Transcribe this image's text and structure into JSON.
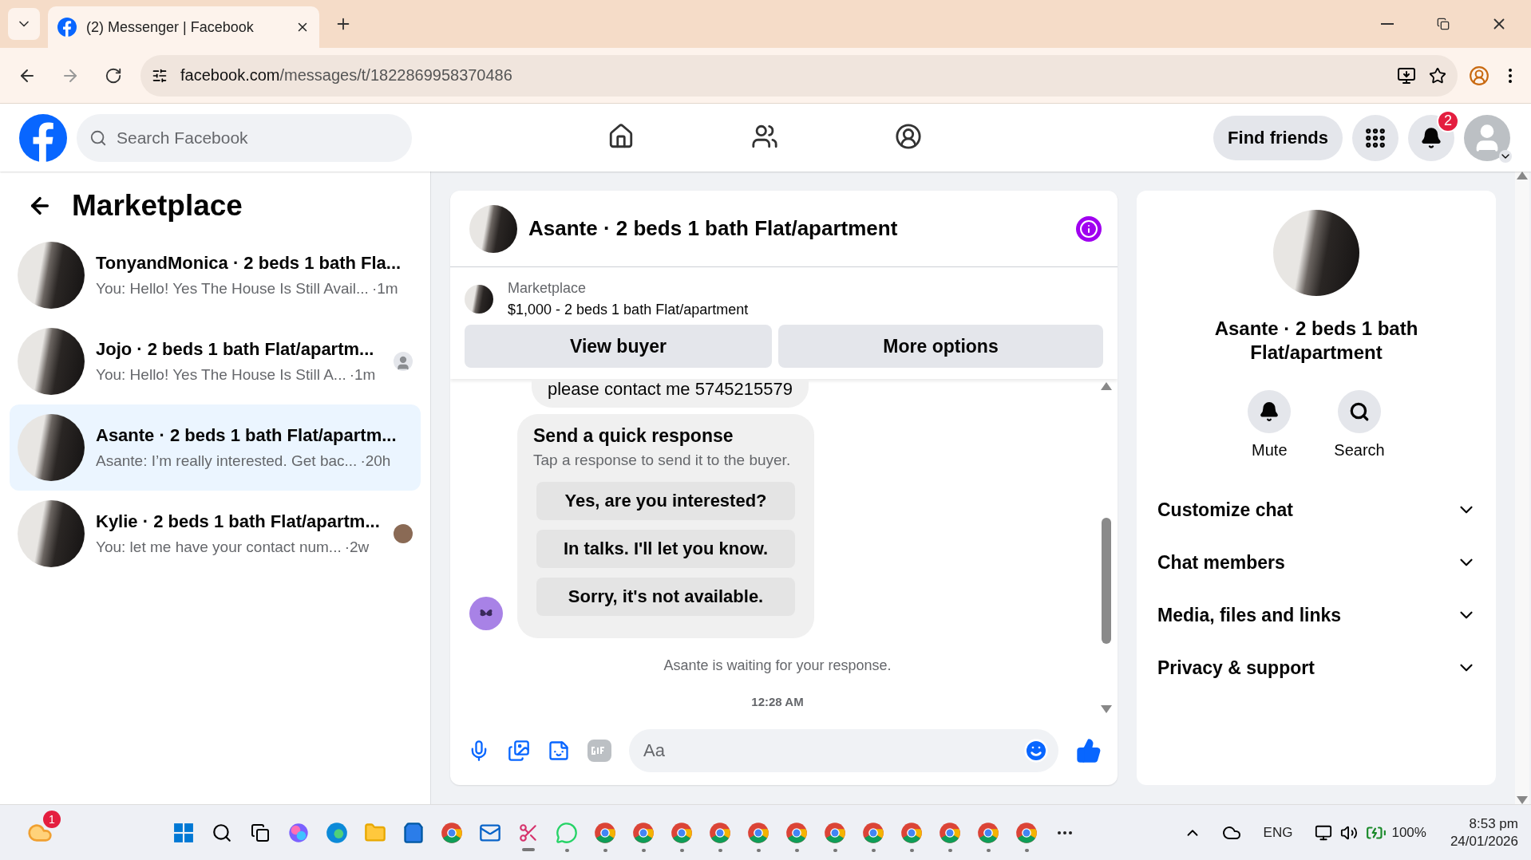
{
  "browser": {
    "tab_title": "(2) Messenger | Facebook",
    "url_host": "facebook.com",
    "url_path": "/messages/t/1822869958370486"
  },
  "header": {
    "search_placeholder": "Search Facebook",
    "find_friends": "Find friends",
    "notification_count": "2",
    "nav": [
      {
        "kind": "home",
        "selected": false
      },
      {
        "kind": "friends",
        "selected": false
      },
      {
        "kind": "groups",
        "selected": false
      }
    ]
  },
  "sidebar": {
    "title": "Marketplace",
    "conversations": [
      {
        "title": "TonyandMonica · 2 beds 1 bath Fla...",
        "preview": "You: Hello! Yes The House Is Still Avail...",
        "time": "·1m",
        "selected": false,
        "kind": "plain"
      },
      {
        "title": "Jojo · 2 beds 1 bath Flat/apartm...",
        "preview": "You: Hello! Yes The House Is Still A...",
        "time": "·1m",
        "selected": false,
        "kind": "seen_silhouette"
      },
      {
        "title": "Asante · 2 beds 1 bath Flat/apartm...",
        "preview": "Asante: I’m really interested. Get bac...",
        "time": "·20h",
        "selected": true,
        "kind": "plain"
      },
      {
        "title": "Kylie · 2 beds 1 bath Flat/apartm...",
        "preview": "You: let me have your contact num...",
        "time": "·2w",
        "selected": false,
        "kind": "seen_photo"
      }
    ]
  },
  "chat": {
    "title": "Asante · 2 beds 1 bath Flat/apartment",
    "listing": {
      "label": "Marketplace",
      "name": "$1,000 - 2 beds 1 bath Flat/apartment"
    },
    "actions": [
      "View buyer",
      "More options"
    ],
    "message": "please contact me 5745215579",
    "quick_response": {
      "title": "Send a quick response",
      "subtitle": "Tap a response to send it to the buyer.",
      "options": [
        "Yes, are you interested?",
        "In talks. I'll let you know.",
        "Sorry, it's not available."
      ]
    },
    "status": "Asante is waiting for your response.",
    "timestamp": "12:28 AM",
    "composer_placeholder": "Aa"
  },
  "details": {
    "title": "Asante · 2 beds 1 bath Flat/apartment",
    "actions": [
      {
        "kind": "mute",
        "label": "Mute"
      },
      {
        "kind": "search",
        "label": "Search"
      }
    ],
    "sections": [
      {
        "label": "Customize chat",
        "expanded": false
      },
      {
        "label": "Chat members",
        "expanded": false
      },
      {
        "label": "Media, files and links",
        "expanded": false
      },
      {
        "label": "Privacy & support",
        "expanded": false
      }
    ]
  },
  "taskbar": {
    "weather_badge": "1",
    "apps": [
      {
        "kind": "start",
        "running": false
      },
      {
        "kind": "search",
        "running": false
      },
      {
        "kind": "taskview",
        "running": false
      },
      {
        "kind": "copilot",
        "running": false
      },
      {
        "kind": "edge",
        "running": false
      },
      {
        "kind": "explorer",
        "running": false
      },
      {
        "kind": "store",
        "running": false
      },
      {
        "kind": "chrome",
        "running": false
      },
      {
        "kind": "outlook",
        "running": false
      },
      {
        "kind": "snip",
        "running": true
      },
      {
        "kind": "whatsapp",
        "running": true
      },
      {
        "kind": "chrome",
        "running": true
      },
      {
        "kind": "chrome",
        "running": true
      },
      {
        "kind": "chrome",
        "running": true
      },
      {
        "kind": "chrome",
        "running": true
      },
      {
        "kind": "chrome",
        "running": true
      },
      {
        "kind": "chrome",
        "running": true
      },
      {
        "kind": "chrome",
        "running": true
      },
      {
        "kind": "chrome",
        "running": true
      },
      {
        "kind": "chrome",
        "running": true
      },
      {
        "kind": "chrome",
        "running": true
      },
      {
        "kind": "chrome",
        "running": true
      },
      {
        "kind": "chrome",
        "running": true
      }
    ],
    "language": "ENG",
    "battery": "100%",
    "time": "8:53 pm",
    "date": "24/01/2026"
  }
}
